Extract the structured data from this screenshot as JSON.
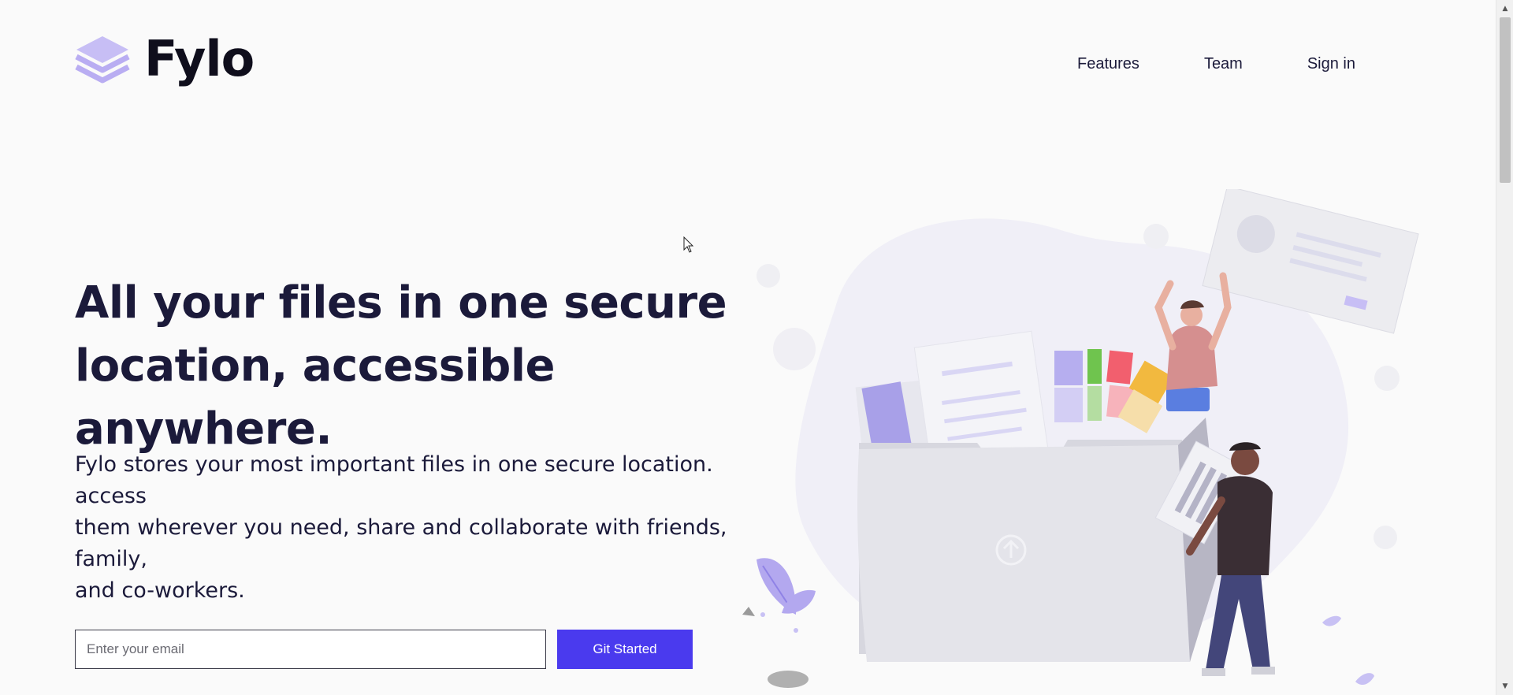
{
  "brand": {
    "name": "Fylo",
    "color": "#0f0e1c",
    "icon": "stacked-layers-icon",
    "icon_color": "#b9adf2"
  },
  "nav": {
    "items": [
      {
        "label": "Features"
      },
      {
        "label": "Team"
      },
      {
        "label": "Sign in"
      }
    ]
  },
  "hero": {
    "title_line1": "All your files in one secure",
    "title_line2": "location, accessible anywhere.",
    "desc_lines": [
      "Fylo stores your most important files in one secure location.",
      "access",
      "them wherever you need, share and collaborate with friends,",
      "family,",
      "and co-workers."
    ]
  },
  "signup": {
    "email_placeholder": "Enter your email",
    "email_value": "",
    "button_label": "Git Started",
    "button_color": "#4a3aee"
  },
  "colors": {
    "background": "#fafafa",
    "text": "#1b1a3a",
    "accent": "#4a3aee"
  }
}
